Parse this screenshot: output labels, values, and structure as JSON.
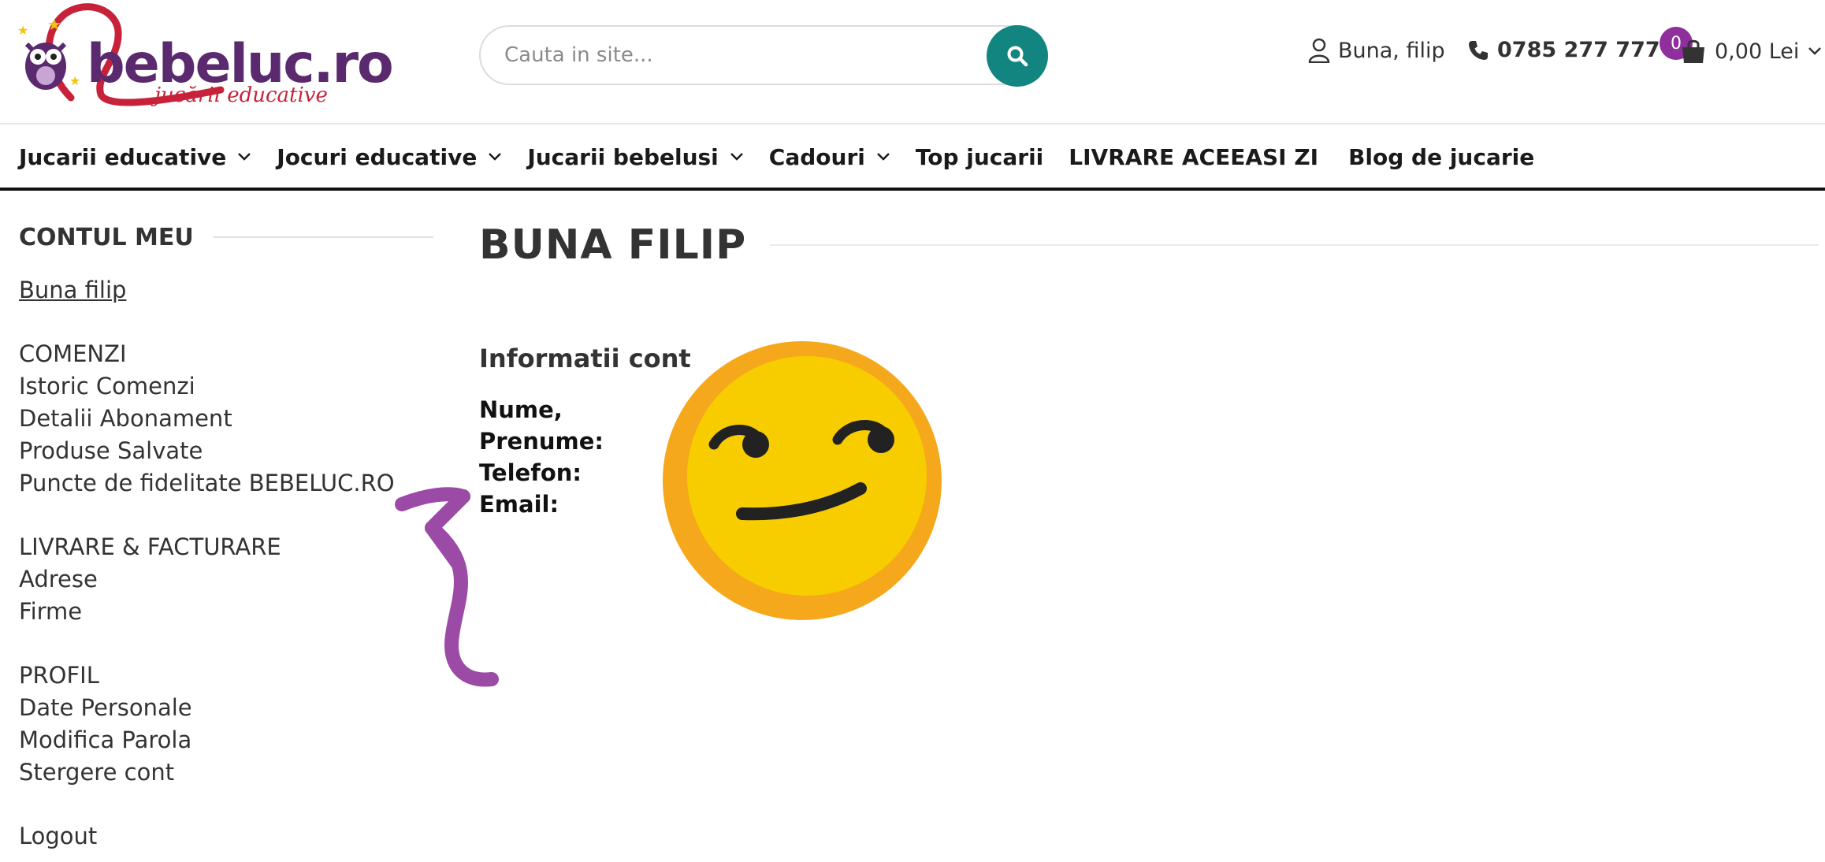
{
  "header": {
    "logo": {
      "brand": "bebeluc.ro",
      "tagline": "jucării educative"
    },
    "search": {
      "placeholder": "Cauta in site..."
    },
    "user_greeting": "Buna, filip",
    "phone": "0785 277 777",
    "cart": {
      "count": "0",
      "total": "0,00 Lei"
    }
  },
  "nav": {
    "items": [
      {
        "label": "Jucarii educative",
        "has_dropdown": true
      },
      {
        "label": "Jocuri educative",
        "has_dropdown": true
      },
      {
        "label": "Jucarii bebelusi",
        "has_dropdown": true
      },
      {
        "label": "Cadouri",
        "has_dropdown": true
      },
      {
        "label": "Top jucarii",
        "has_dropdown": false
      },
      {
        "label": "LIVRARE ACEEASI ZI",
        "has_dropdown": false
      },
      {
        "label": "Blog de jucarie",
        "has_dropdown": false
      }
    ]
  },
  "sidebar": {
    "title": "CONTUL MEU",
    "greeting": "Buna filip",
    "groups": [
      {
        "heading": "COMENZI",
        "items": [
          "Istoric Comenzi",
          "Detalii Abonament",
          "Produse Salvate",
          "Puncte de fidelitate BEBELUC.RO"
        ]
      },
      {
        "heading": "LIVRARE & FACTURARE",
        "items": [
          "Adrese",
          "Firme"
        ]
      },
      {
        "heading": "PROFIL",
        "items": [
          "Date Personale",
          "Modifica Parola",
          "Stergere cont"
        ]
      }
    ],
    "logout": "Logout"
  },
  "main": {
    "title": "BUNA FILIP",
    "info_heading": "Informatii cont",
    "fields": [
      "Nume,",
      "Prenume:",
      "Telefon:",
      "Email:"
    ]
  },
  "colors": {
    "brand_purple": "#5b2a6e",
    "brand_red": "#c8223a",
    "search_button": "#128580",
    "cart_badge": "#8e2f9b",
    "arrow": "#9b4aa6",
    "emoji_face": "#f7cd00",
    "emoji_rim": "#f6a81c"
  },
  "icons": {
    "search_button": "search-icon",
    "user": "user-icon",
    "phone": "phone-icon",
    "cart": "shopping-bag-icon",
    "dropdown": "chevron-down-icon"
  }
}
